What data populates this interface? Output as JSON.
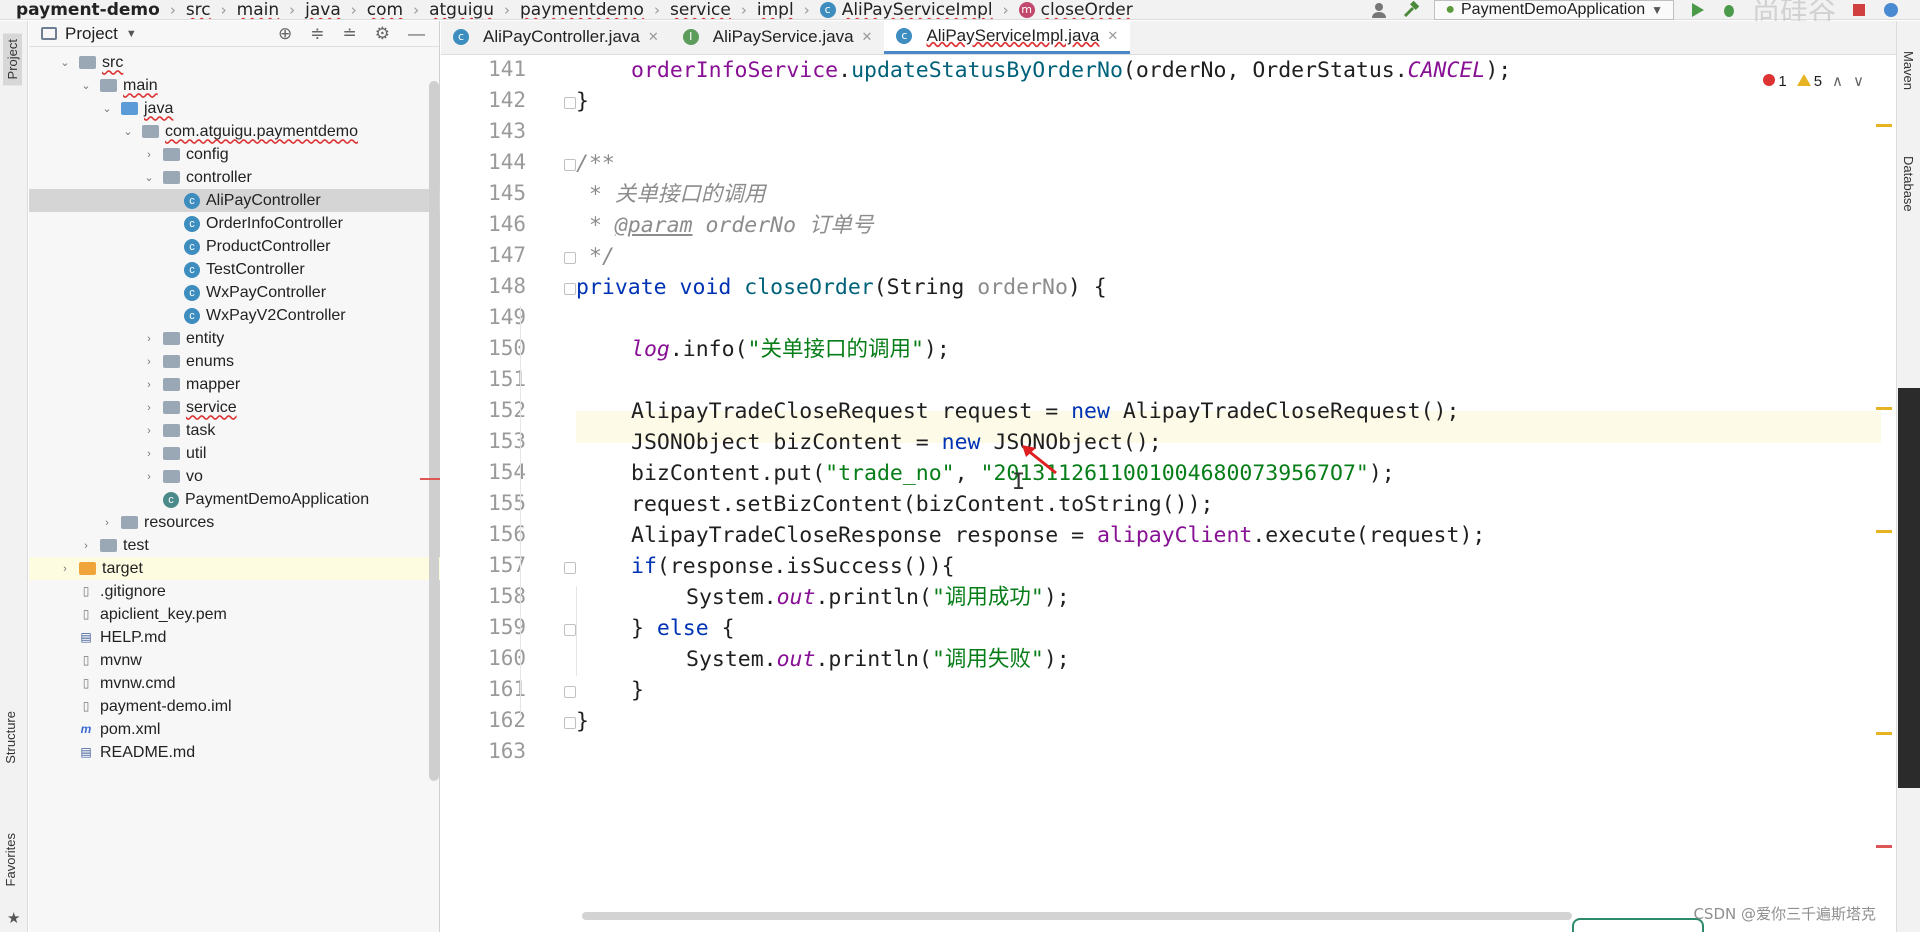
{
  "breadcrumb": {
    "items": [
      "payment-demo",
      "src",
      "main",
      "java",
      "com",
      "atguigu",
      "paymentdemo",
      "service",
      "impl"
    ],
    "class_name": "AliPayServiceImpl",
    "method_name": "closeOrder"
  },
  "toolbar": {
    "run_config": "PaymentDemoApplication",
    "watermark": "尚硅谷"
  },
  "left_strip": {
    "project_tab": "Project",
    "structure_tab": "Structure",
    "favorites_tab": "Favorites"
  },
  "right_strip": {
    "maven_tab": "Maven",
    "database_tab": "Database"
  },
  "project_panel": {
    "title": "Project",
    "tree": [
      {
        "label": "src",
        "type": "folder",
        "depth": 2,
        "expanded": true,
        "wavy": true
      },
      {
        "label": "main",
        "type": "folder",
        "depth": 3,
        "expanded": true,
        "wavy": true
      },
      {
        "label": "java",
        "type": "folder-blue",
        "depth": 4,
        "expanded": true,
        "wavy": true
      },
      {
        "label": "com.atguigu.paymentdemo",
        "type": "package",
        "depth": 5,
        "expanded": true,
        "wavy": true
      },
      {
        "label": "config",
        "type": "package",
        "depth": 6,
        "expanded": false
      },
      {
        "label": "controller",
        "type": "package",
        "depth": 6,
        "expanded": true
      },
      {
        "label": "AliPayController",
        "type": "class",
        "depth": 7,
        "selected": true
      },
      {
        "label": "OrderInfoController",
        "type": "class",
        "depth": 7
      },
      {
        "label": "ProductController",
        "type": "class",
        "depth": 7
      },
      {
        "label": "TestController",
        "type": "class",
        "depth": 7
      },
      {
        "label": "WxPayController",
        "type": "class",
        "depth": 7
      },
      {
        "label": "WxPayV2Controller",
        "type": "class",
        "depth": 7
      },
      {
        "label": "entity",
        "type": "package",
        "depth": 6,
        "expanded": false
      },
      {
        "label": "enums",
        "type": "package",
        "depth": 6,
        "expanded": false
      },
      {
        "label": "mapper",
        "type": "package",
        "depth": 6,
        "expanded": false
      },
      {
        "label": "service",
        "type": "package",
        "depth": 6,
        "expanded": false,
        "wavy": true
      },
      {
        "label": "task",
        "type": "package",
        "depth": 6,
        "expanded": false
      },
      {
        "label": "util",
        "type": "package",
        "depth": 6,
        "expanded": false
      },
      {
        "label": "vo",
        "type": "package",
        "depth": 6,
        "expanded": false
      },
      {
        "label": "PaymentDemoApplication",
        "type": "app",
        "depth": 6
      },
      {
        "label": "resources",
        "type": "folder",
        "depth": 4,
        "expanded": false
      },
      {
        "label": "test",
        "type": "folder",
        "depth": 3,
        "expanded": false
      },
      {
        "label": "target",
        "type": "folder-orange",
        "depth": 2,
        "expanded": false,
        "highlighted": true
      },
      {
        "label": ".gitignore",
        "type": "file",
        "depth": 2
      },
      {
        "label": "apiclient_key.pem",
        "type": "file",
        "depth": 2
      },
      {
        "label": "HELP.md",
        "type": "md",
        "depth": 2
      },
      {
        "label": "mvnw",
        "type": "file",
        "depth": 2
      },
      {
        "label": "mvnw.cmd",
        "type": "file",
        "depth": 2
      },
      {
        "label": "payment-demo.iml",
        "type": "file",
        "depth": 2
      },
      {
        "label": "pom.xml",
        "type": "maven",
        "depth": 2
      },
      {
        "label": "README.md",
        "type": "md",
        "depth": 2
      }
    ]
  },
  "tabs": [
    {
      "label": "AliPayController.java",
      "icon": "class-icon",
      "active": false
    },
    {
      "label": "AliPayService.java",
      "icon": "interface-icon",
      "active": false
    },
    {
      "label": "AliPayServiceImpl.java",
      "icon": "class-icon",
      "active": true
    }
  ],
  "inspections": {
    "errors": "1",
    "warnings": "5"
  },
  "editor": {
    "lines": [
      {
        "n": "141",
        "indent": 2,
        "tokens": [
          [
            "fld",
            "orderInfoService"
          ],
          [
            "",
            "."
          ],
          [
            "fn",
            "updateStatusByOrderNo"
          ],
          [
            "",
            "(orderNo, OrderStatus."
          ],
          [
            "fld-i",
            "CANCEL"
          ],
          [
            "",
            ");"
          ]
        ]
      },
      {
        "n": "142",
        "indent": 1,
        "tokens": [
          [
            "",
            "}"
          ]
        ]
      },
      {
        "n": "143",
        "indent": 0,
        "tokens": []
      },
      {
        "n": "144",
        "indent": 1,
        "tokens": [
          [
            "cmt",
            "/**"
          ]
        ]
      },
      {
        "n": "145",
        "indent": 1,
        "tokens": [
          [
            "cmt",
            " * 关单接口的调用"
          ]
        ]
      },
      {
        "n": "146",
        "indent": 1,
        "tokens": [
          [
            "cmt",
            " * "
          ],
          [
            "tag",
            "@param"
          ],
          [
            "cmt",
            " orderNo 订单号"
          ]
        ]
      },
      {
        "n": "147",
        "indent": 1,
        "tokens": [
          [
            "cmt",
            " */"
          ]
        ]
      },
      {
        "n": "148",
        "indent": 1,
        "tokens": [
          [
            "kw",
            "private void "
          ],
          [
            "fn",
            "closeOrder"
          ],
          [
            "",
            "(String "
          ],
          [
            "param",
            "orderNo"
          ],
          [
            "",
            ") {"
          ]
        ]
      },
      {
        "n": "149",
        "indent": 0,
        "tokens": []
      },
      {
        "n": "150",
        "indent": 2,
        "tokens": [
          [
            "fld-i",
            "log"
          ],
          [
            "",
            ".info("
          ],
          [
            "str",
            "\"关单接口的调用\""
          ],
          [
            "",
            ");"
          ]
        ]
      },
      {
        "n": "151",
        "indent": 0,
        "tokens": []
      },
      {
        "n": "152",
        "indent": 2,
        "tokens": [
          [
            "",
            "AlipayTradeCloseRequest request = "
          ],
          [
            "kw",
            "new "
          ],
          [
            "",
            "AlipayTradeCloseRequest();"
          ]
        ]
      },
      {
        "n": "153",
        "indent": 2,
        "tokens": [
          [
            "",
            "JSONObject bizContent = "
          ],
          [
            "kw",
            "new "
          ],
          [
            "",
            "JSONObject();"
          ]
        ]
      },
      {
        "n": "154",
        "indent": 2,
        "tokens": [
          [
            "",
            "bizContent.put("
          ],
          [
            "str",
            "\"trade_no\""
          ],
          [
            "",
            ", "
          ],
          [
            "str",
            "\"20131126110010046800739567O7\""
          ],
          [
            "",
            ");"
          ]
        ]
      },
      {
        "n": "155",
        "indent": 2,
        "tokens": [
          [
            "",
            "request.setBizContent(bizContent.toString());"
          ]
        ]
      },
      {
        "n": "156",
        "indent": 2,
        "tokens": [
          [
            "",
            "AlipayTradeCloseResponse response = "
          ],
          [
            "fld",
            "alipayClient"
          ],
          [
            "",
            ".execute(request);"
          ]
        ]
      },
      {
        "n": "157",
        "indent": 2,
        "tokens": [
          [
            "kw",
            "if"
          ],
          [
            "",
            "(response.isSuccess()){"
          ]
        ]
      },
      {
        "n": "158",
        "indent": 3,
        "tokens": [
          [
            "",
            "System."
          ],
          [
            "fld-i",
            "out"
          ],
          [
            "",
            ".println("
          ],
          [
            "str",
            "\"调用成功\""
          ],
          [
            "",
            ");"
          ]
        ]
      },
      {
        "n": "159",
        "indent": 2,
        "tokens": [
          [
            "",
            "} "
          ],
          [
            "kw",
            "else"
          ],
          [
            "",
            " {"
          ]
        ]
      },
      {
        "n": "160",
        "indent": 3,
        "tokens": [
          [
            "",
            "System."
          ],
          [
            "fld-i",
            "out"
          ],
          [
            "",
            ".println("
          ],
          [
            "str",
            "\"调用失败\""
          ],
          [
            "",
            ");"
          ]
        ]
      },
      {
        "n": "161",
        "indent": 2,
        "tokens": [
          [
            "",
            "}"
          ]
        ]
      },
      {
        "n": "162",
        "indent": 1,
        "tokens": [
          [
            "",
            "}"
          ]
        ]
      },
      {
        "n": "163",
        "indent": 0,
        "tokens": []
      }
    ]
  },
  "footer": {
    "watermark": "CSDN @爱你三千遍斯塔克"
  },
  "colors": {
    "keyword": "#0033b3",
    "string": "#067d17",
    "field": "#871094",
    "method": "#00627a",
    "comment": "#8c8c8c",
    "annotation_arrow": "#e02020"
  }
}
